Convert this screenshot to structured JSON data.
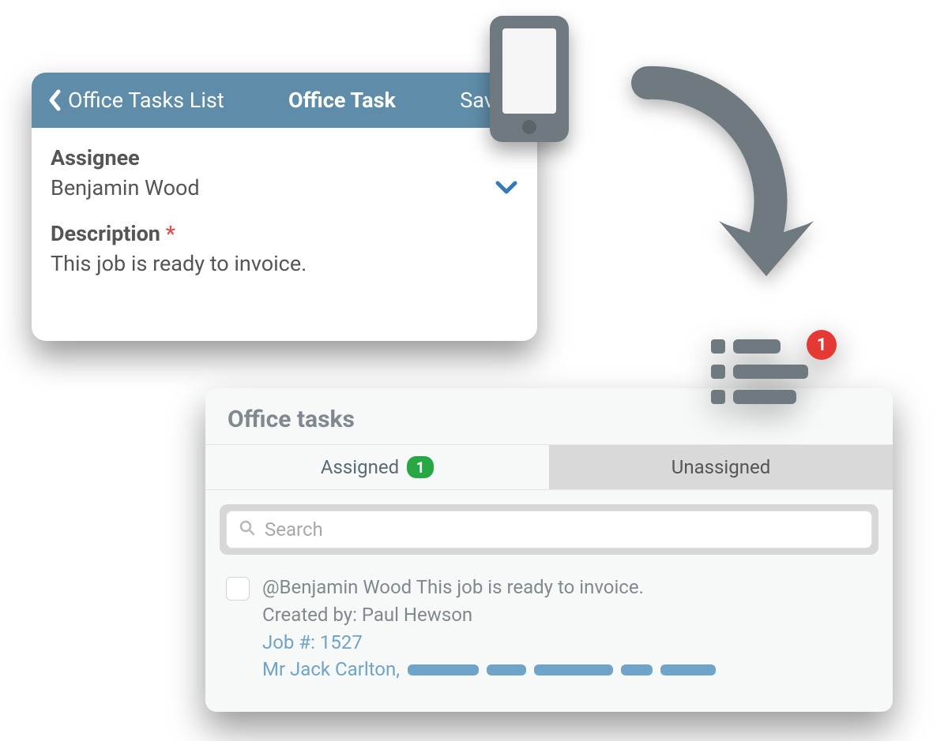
{
  "form": {
    "back_label": "Office Tasks List",
    "title": "Office Task",
    "save_label": "Save",
    "assignee": {
      "label": "Assignee",
      "value": "Benjamin Wood"
    },
    "description": {
      "label": "Description",
      "required": "*",
      "value": "This job is ready to invoice."
    }
  },
  "list_icon": {
    "badge": "1"
  },
  "tasks_panel": {
    "title": "Office tasks",
    "tabs": {
      "assigned": {
        "label": "Assigned",
        "count": "1"
      },
      "unassigned": {
        "label": "Unassigned"
      }
    },
    "search": {
      "placeholder": "Search"
    },
    "items": [
      {
        "line1": "@Benjamin Wood This job is ready to invoice.",
        "created_by": "Created by: Paul Hewson",
        "job": "Job #: 1527",
        "client": "Mr Jack Carlton,"
      }
    ]
  }
}
